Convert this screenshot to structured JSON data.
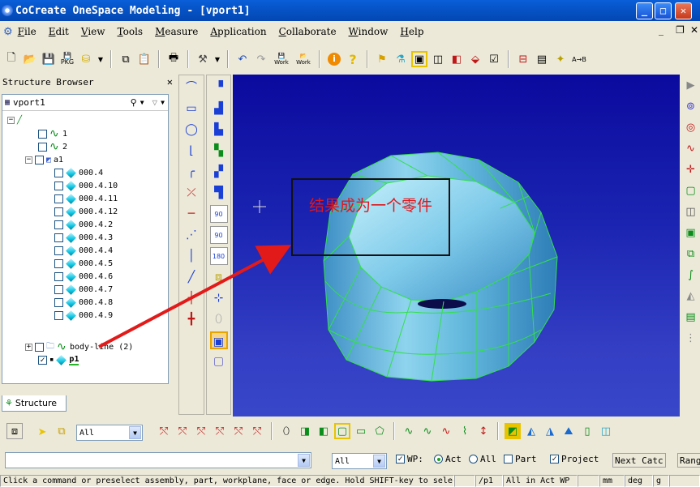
{
  "window": {
    "title": "CoCreate OneSpace Modeling - [vport1]",
    "min": "_",
    "max": "□",
    "close": "✕"
  },
  "menu": [
    "File",
    "Edit",
    "View",
    "Tools",
    "Measure",
    "Application",
    "Collaborate",
    "Window",
    "Help"
  ],
  "mdi": {
    "min": "_",
    "restore": "❐",
    "close": "✕"
  },
  "toolbar_labels": {
    "pkg": "PKG",
    "work1": "Work",
    "work2": "Work"
  },
  "browser": {
    "title": "Structure Browser",
    "viewport_name": "vport1",
    "rows": [
      {
        "label": "1",
        "icon": "wave-icon"
      },
      {
        "label": "2",
        "icon": "wave-icon"
      },
      {
        "label": "a1",
        "icon": "assembly-icon"
      },
      {
        "label": "000.4",
        "icon": "part-icon"
      },
      {
        "label": "000.4.10",
        "icon": "part-icon"
      },
      {
        "label": "000.4.11",
        "icon": "part-icon"
      },
      {
        "label": "000.4.12",
        "icon": "part-icon"
      },
      {
        "label": "000.4.2",
        "icon": "part-icon"
      },
      {
        "label": "000.4.3",
        "icon": "part-icon"
      },
      {
        "label": "000.4.4",
        "icon": "part-icon"
      },
      {
        "label": "000.4.5",
        "icon": "part-icon"
      },
      {
        "label": "000.4.6",
        "icon": "part-icon"
      },
      {
        "label": "000.4.7",
        "icon": "part-icon"
      },
      {
        "label": "000.4.8",
        "icon": "part-icon"
      },
      {
        "label": "000.4.9",
        "icon": "part-icon"
      },
      {
        "label": "body-line (2)",
        "icon": "folder-icon"
      },
      {
        "label": "p1",
        "icon": "part-icon"
      }
    ],
    "tab": "Structure"
  },
  "vtools": {
    "rot90a": "90",
    "rot90b": "90",
    "rot180": "180"
  },
  "annotation": {
    "text": "结果成为一个零件"
  },
  "bottom": {
    "filter_value": "All",
    "filter2_value": "All",
    "wp_label": "WP:",
    "act_label": "Act",
    "all_label": "All",
    "part_label": "Part",
    "project_label": "Project",
    "next_label": "Next Catc",
    "range_label": "Rang"
  },
  "status": {
    "prompt": "Click a command or preselect assembly, part, workplane, face or edge. Hold SHIFT-key to selec",
    "part": "/p1",
    "wp": "All in Act WP",
    "unit_len": "mm",
    "unit_ang": "deg",
    "unit_g": "g"
  },
  "colors": {
    "viewport_top": "#0b0a9e",
    "viewport_bottom": "#3847c9",
    "edge_green": "#33e04a",
    "annotation_red": "#e0161c"
  }
}
